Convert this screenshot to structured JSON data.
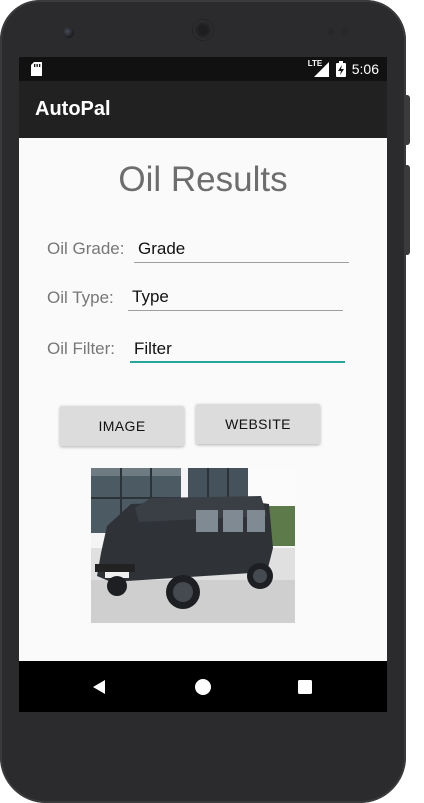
{
  "status_bar": {
    "network": "LTE",
    "time": "5:06"
  },
  "app_bar": {
    "title": "AutoPal"
  },
  "main": {
    "heading": "Oil Results",
    "oil_grade": {
      "label": "Oil Grade:",
      "value": "Grade"
    },
    "oil_type": {
      "label": "Oil Type:",
      "value": "Type"
    },
    "oil_filter": {
      "label": "Oil Filter:",
      "value": "Filter"
    },
    "image_button": "IMAGE",
    "website_button": "WEBSITE",
    "photo": {
      "icon": "car-photo"
    }
  },
  "nav_bar": {
    "back_icon": "back-triangle-icon",
    "home_icon": "home-circle-icon",
    "recents_icon": "recents-square-icon"
  },
  "colors": {
    "app_bar": "#212121",
    "status_bar": "#111111",
    "accent": "#26a69a",
    "screen_bg": "#fafafa",
    "phone_body": "#2b2b2d"
  }
}
